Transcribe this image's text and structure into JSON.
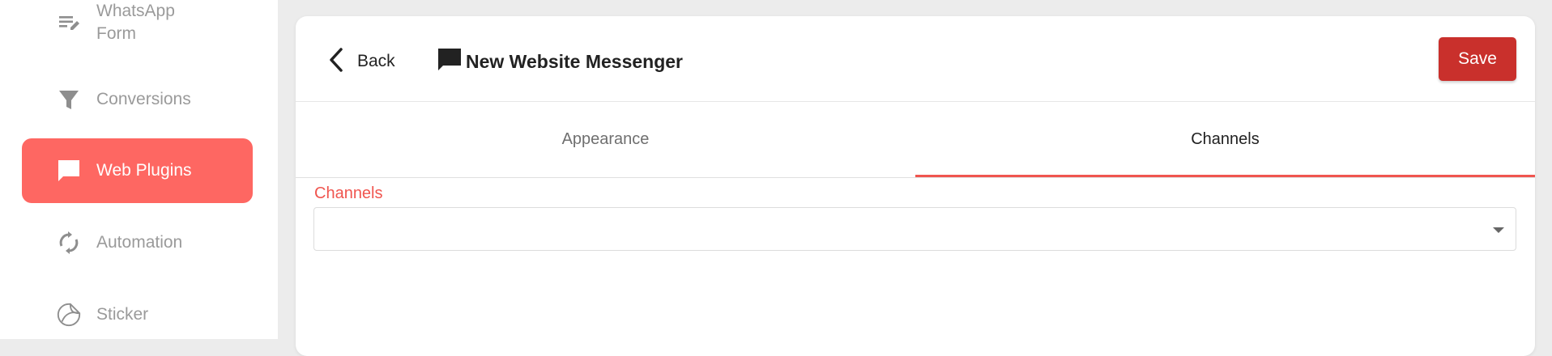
{
  "sidebar": {
    "items": [
      {
        "label_line1": "WhatsApp",
        "label_line2": "Form",
        "icon": "form-list-icon",
        "active": false
      },
      {
        "label": "Conversions",
        "icon": "filter-icon",
        "active": false
      },
      {
        "label": "Web Plugins",
        "icon": "chat-bubble-icon",
        "active": true
      },
      {
        "label": "Automation",
        "icon": "sync-icon",
        "active": false
      },
      {
        "label": "Sticker",
        "icon": "sticker-icon",
        "active": false
      }
    ]
  },
  "header": {
    "back_label": "Back",
    "title": "New Website Messenger",
    "save_label": "Save"
  },
  "tabs": [
    {
      "label": "Appearance",
      "active": false
    },
    {
      "label": "Channels",
      "active": true
    }
  ],
  "form": {
    "channels_label": "Channels",
    "channels_value": ""
  },
  "colors": {
    "accent": "#fe6762",
    "save_button": "#c9302c",
    "tab_indicator": "#f0554f"
  }
}
